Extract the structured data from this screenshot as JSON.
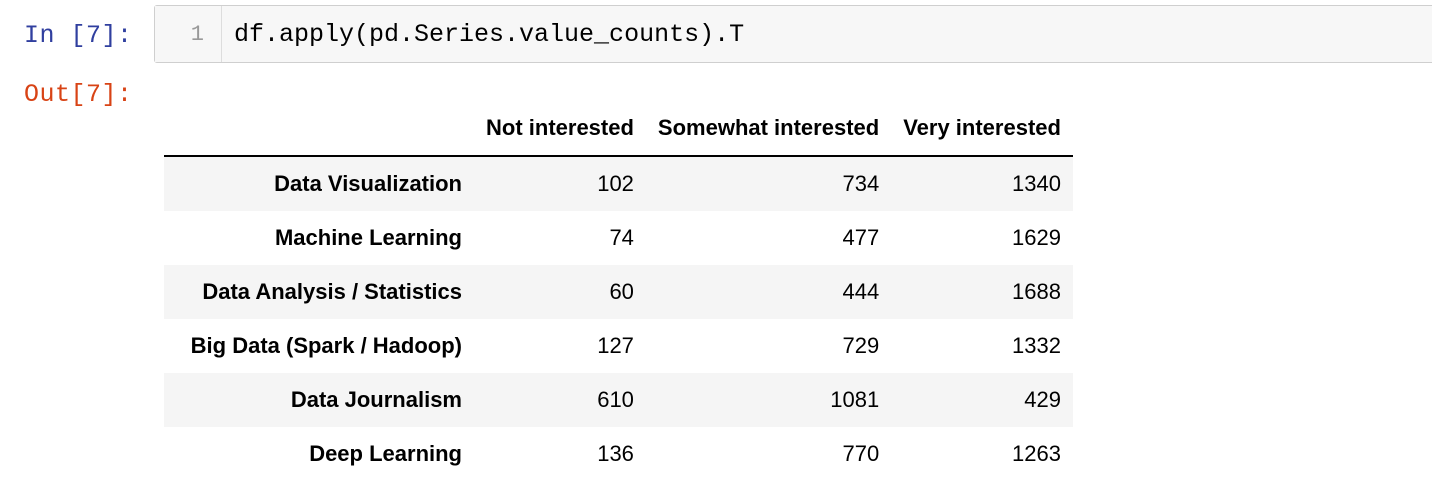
{
  "cell": {
    "input_prompt": "In [7]:",
    "output_prompt": "Out[7]:",
    "line_number": "1",
    "code": "df.apply(pd.Series.value_counts).T"
  },
  "table": {
    "columns": [
      "Not interested",
      "Somewhat interested",
      "Very interested"
    ],
    "rows": [
      {
        "index": "Data Visualization",
        "values": [
          "102",
          "734",
          "1340"
        ]
      },
      {
        "index": "Machine Learning",
        "values": [
          "74",
          "477",
          "1629"
        ]
      },
      {
        "index": "Data Analysis / Statistics",
        "values": [
          "60",
          "444",
          "1688"
        ]
      },
      {
        "index": "Big Data (Spark / Hadoop)",
        "values": [
          "127",
          "729",
          "1332"
        ]
      },
      {
        "index": "Data Journalism",
        "values": [
          "610",
          "1081",
          "429"
        ]
      },
      {
        "index": "Deep Learning",
        "values": [
          "136",
          "770",
          "1263"
        ]
      }
    ]
  }
}
